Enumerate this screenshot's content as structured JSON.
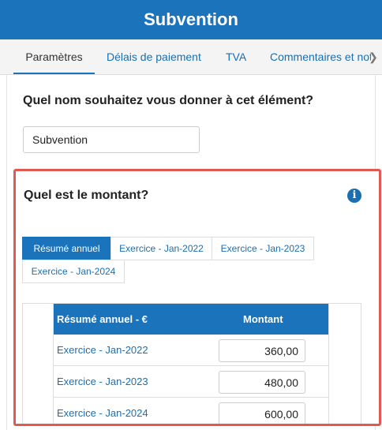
{
  "header": {
    "title": "Subvention"
  },
  "tabs": [
    {
      "label": "Paramètres",
      "active": true
    },
    {
      "label": "Délais de paiement",
      "active": false
    },
    {
      "label": "TVA",
      "active": false
    },
    {
      "label": "Commentaires et notes",
      "active": false
    }
  ],
  "name_question": "Quel nom souhaitez vous donner à cet élément?",
  "name_input": {
    "value": "Subvention"
  },
  "amount_section": {
    "question": "Quel est le montant?",
    "info_icon": "i",
    "period_tabs": [
      {
        "label": "Résumé annuel",
        "active": true
      },
      {
        "label": "Exercice - Jan-2022",
        "active": false
      },
      {
        "label": "Exercice - Jan-2023",
        "active": false
      },
      {
        "label": "Exercice - Jan-2024",
        "active": false
      }
    ],
    "table": {
      "header_label": "Résumé annuel - €",
      "header_amount": "Montant",
      "rows": [
        {
          "label": "Exercice - Jan-2022",
          "amount": "360,00"
        },
        {
          "label": "Exercice - Jan-2023",
          "amount": "480,00"
        },
        {
          "label": "Exercice - Jan-2024",
          "amount": "600,00"
        }
      ]
    }
  },
  "colors": {
    "primary": "#1a73bb",
    "highlight_border": "#e05a52",
    "link": "#1a6fb0"
  }
}
